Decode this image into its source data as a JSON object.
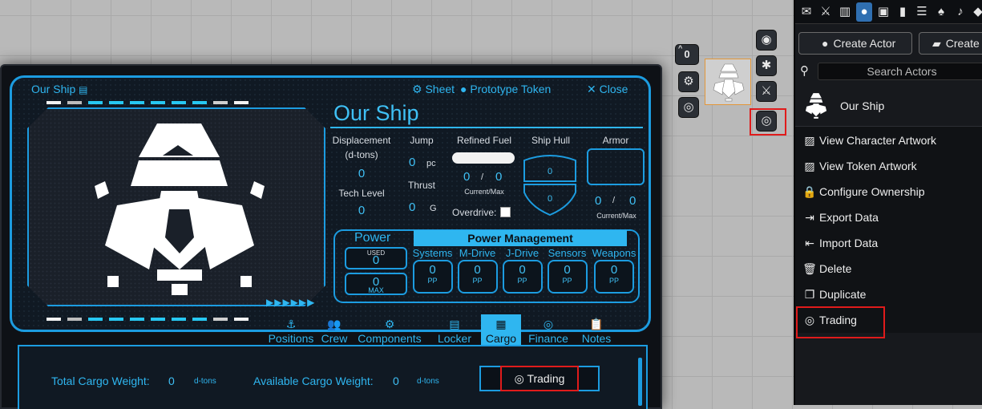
{
  "sheet": {
    "header_name": "Our Ship",
    "header_sheet": "Sheet",
    "header_token": "Prototype Token",
    "header_close": "Close",
    "ship_name": "Our Ship",
    "stats": {
      "displacement_label": "Displacement",
      "displacement_unit": "(d-tons)",
      "displacement_value": "0",
      "tech_label": "Tech Level",
      "tech_value": "0",
      "jump_label": "Jump",
      "jump_value": "0",
      "jump_unit": "pc",
      "thrust_label": "Thrust",
      "thrust_value": "0",
      "thrust_unit": "G",
      "fuel_label": "Refined Fuel",
      "fuel_current": "0",
      "fuel_sep": "/",
      "fuel_max": "0",
      "fuel_caption": "Current/Max",
      "overdrive_label": "Overdrive:",
      "hull_label": "Ship Hull",
      "hull_top": "0",
      "hull_bottom": "0",
      "armor_label": "Armor",
      "armor_current": "0",
      "armor_sep": "/",
      "armor_max": "0",
      "armor_caption": "Current/Max"
    },
    "power": {
      "title": "Power",
      "used_label": "USED",
      "used_value": "0",
      "max_value": "0",
      "max_label": "MAX",
      "management_title": "Power Management",
      "systems": [
        {
          "label": "Systems",
          "value": "0",
          "unit": "PP"
        },
        {
          "label": "M-Drive",
          "value": "0",
          "unit": "PP"
        },
        {
          "label": "J-Drive",
          "value": "0",
          "unit": "PP"
        },
        {
          "label": "Sensors",
          "value": "0",
          "unit": "PP"
        },
        {
          "label": "Weapons",
          "value": "0",
          "unit": "PP"
        }
      ]
    },
    "tabs": [
      {
        "label": "Positions",
        "icon": "positions-icon"
      },
      {
        "label": "Crew",
        "icon": "users-icon"
      },
      {
        "label": "Components",
        "icon": "cogs-icon"
      },
      {
        "label": "Locker",
        "icon": "locker-icon"
      },
      {
        "label": "Cargo",
        "icon": "cargo-icon"
      },
      {
        "label": "Finance",
        "icon": "coins-icon"
      },
      {
        "label": "Notes",
        "icon": "clipboard-icon"
      }
    ],
    "cargo": {
      "total_label": "Total Cargo Weight:",
      "total_value": "0",
      "total_unit": "d-tons",
      "available_label": "Available Cargo Weight:",
      "available_value": "0",
      "available_unit": "d-tons",
      "trading_button": "Trading"
    }
  },
  "hud": {
    "counter": "0"
  },
  "sidebar": {
    "create_actor": "Create Actor",
    "create_folder": "Create",
    "search_placeholder": "Search Actors",
    "actor_name": "Our Ship",
    "context_menu": [
      {
        "label": "View Character Artwork",
        "icon": "image-icon"
      },
      {
        "label": "View Token Artwork",
        "icon": "image-icon"
      },
      {
        "label": "Configure Ownership",
        "icon": "lock-icon"
      },
      {
        "label": "Export Data",
        "icon": "file-export-icon"
      },
      {
        "label": "Import Data",
        "icon": "file-import-icon"
      },
      {
        "label": "Delete",
        "icon": "trash-icon"
      },
      {
        "label": "Duplicate",
        "icon": "copy-icon"
      },
      {
        "label": "Trading",
        "icon": "coins-icon"
      }
    ]
  },
  "colors": {
    "accent": "#2fb6f0",
    "highlight": "#e01b1b",
    "sidebar_active": "#2f6fb1"
  }
}
